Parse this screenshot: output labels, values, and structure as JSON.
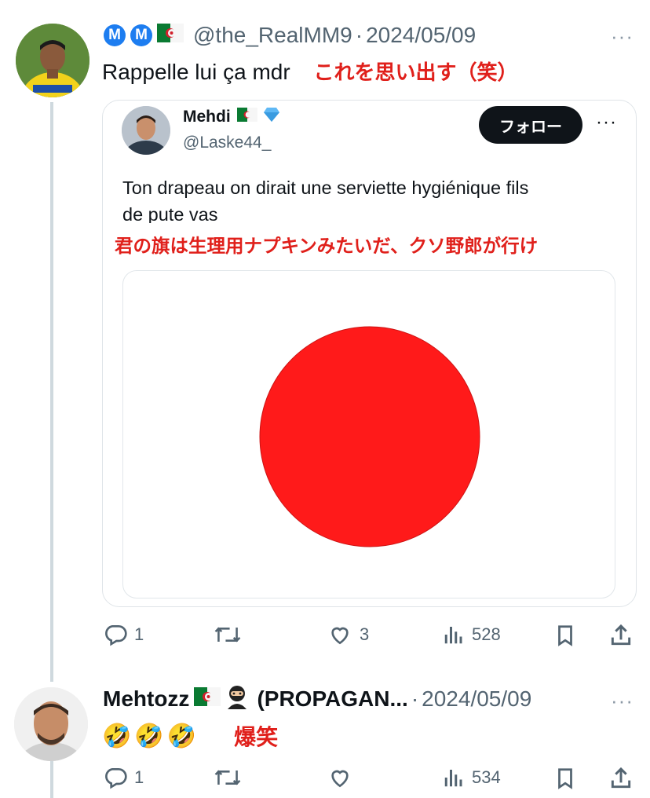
{
  "tweet1": {
    "badges": [
      "M",
      "M"
    ],
    "handle": "@the_RealMM9",
    "separator": "·",
    "date": "2024/05/09",
    "more": "···",
    "text": "Rappelle lui ça mdr",
    "translation": "これを思い出す（笑）",
    "stats": {
      "replies": "1",
      "retweets": "",
      "likes": "3",
      "views": "528"
    }
  },
  "quote": {
    "name": "Mehdi",
    "handle": "@Laske44_",
    "follow_label": "フォロー",
    "more": "···",
    "text_line1": "Ton drapeau on dirait une serviette hygiénique fils",
    "text_line2": "de pute vas",
    "translation": "君の旗は生理用ナプキンみたいだ、クソ野郎が行け",
    "flag_colors": {
      "background": "#ffffff",
      "disc": "#ff1a1a"
    }
  },
  "tweet2": {
    "name": "Mehtozz",
    "name_suffix": "(PROPAGAN...",
    "separator": "·",
    "date": "2024/05/09",
    "more": "···",
    "emojis": "🤣🤣🤣",
    "translation": "爆笑",
    "stats": {
      "replies": "1",
      "retweets": "",
      "likes": "",
      "views": "534"
    }
  },
  "icons": [
    "reply-icon",
    "retweet-icon",
    "like-icon",
    "views-icon",
    "bookmark-icon",
    "share-icon",
    "verified-icon",
    "algeria-flag-icon",
    "ninja-icon"
  ],
  "colors": {
    "accent": "#1d9bf0",
    "jp_red": "#e0201b",
    "muted": "#536471"
  }
}
